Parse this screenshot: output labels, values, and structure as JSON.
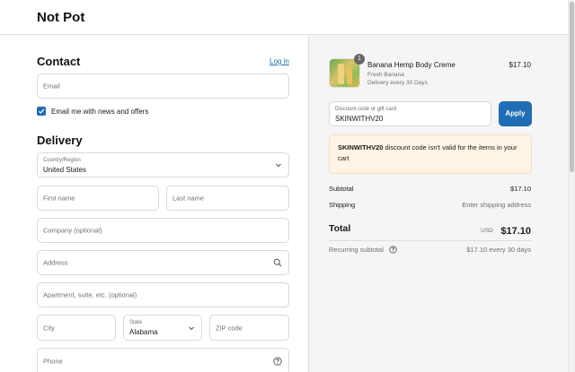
{
  "header": {
    "brand": "Not Pot"
  },
  "contact": {
    "title": "Contact",
    "login_link": "Log in",
    "email_placeholder": "Email",
    "newsletter_label": "Email me with news and offers",
    "newsletter_checked": true
  },
  "delivery": {
    "title": "Delivery",
    "country_label": "Country/Region",
    "country_value": "United States",
    "first_name_placeholder": "First name",
    "last_name_placeholder": "Last name",
    "company_placeholder": "Company (optional)",
    "address_placeholder": "Address",
    "apartment_placeholder": "Apartment, suite, etc. (optional)",
    "city_placeholder": "City",
    "state_label": "State",
    "state_value": "Alabama",
    "zip_placeholder": "ZIP code",
    "phone_placeholder": "Phone"
  },
  "summary": {
    "product": {
      "quantity": "1",
      "name": "Banana Hemp Body Creme",
      "variant": "Fresh Banana",
      "delivery": "Delivery every 30 Days",
      "price": "$17.10"
    },
    "discount": {
      "label": "Discount code or gift card",
      "value": "SKINWITHV20",
      "apply_label": "Apply"
    },
    "notice": {
      "code": "SKINWITHV20",
      "message": "discount code isn't valid for the items in your cart"
    },
    "subtotal_label": "Subtotal",
    "subtotal_value": "$17.10",
    "shipping_label": "Shipping",
    "shipping_value": "Enter shipping address",
    "total_label": "Total",
    "total_currency": "USD",
    "total_value": "$17.10",
    "recurring_label": "Recurring subtotal",
    "recurring_value": "$17.10 every 30 days"
  },
  "colors": {
    "accent": "#1f6db4",
    "notice_bg": "#fff4e5",
    "link": "#1a6fb0"
  },
  "icons": [
    "search-icon",
    "chevron-down-icon",
    "help-icon",
    "check-icon"
  ]
}
